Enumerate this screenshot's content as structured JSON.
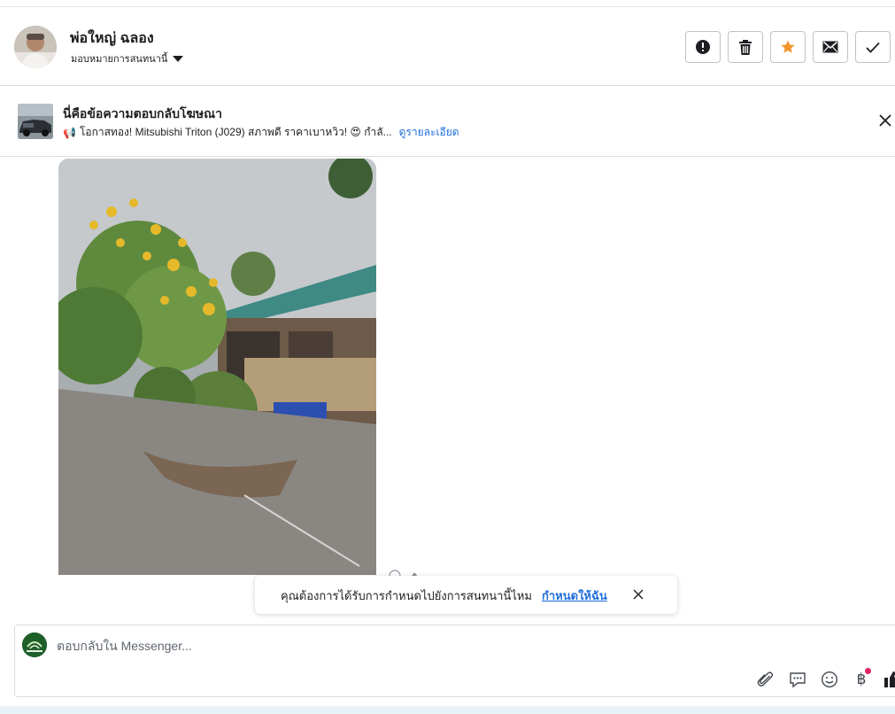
{
  "header": {
    "contact_name": "พ่อใหญ่ ฉลอง",
    "assign_label": "มอบหมายการสนทนานี้",
    "action_icons": [
      "alert-circle-icon",
      "trash-icon",
      "star-icon",
      "envelope-icon",
      "check-icon"
    ],
    "accent_star_color": "#f5942a"
  },
  "ad_banner": {
    "title": "นี่คือข้อความตอบกลับโฆษณา",
    "emoji_prefix": "📢",
    "subtitle": "โอกาสทอง! Mitsubishi Triton (J029) สภาพดี ราคาเบาหวิว! 😍 กำลั...",
    "details_link": "ดูรายละเอียด"
  },
  "message": {
    "type": "image",
    "description_icons": [
      "emoji-react-icon",
      "share-icon"
    ]
  },
  "toast": {
    "text": "คุณต้องการได้รับการกำหนดไปยังการสนทนานี้ไหม",
    "link": "กำหนดให้ฉัน"
  },
  "composer": {
    "placeholder": "ตอบกลับใน Messenger...",
    "tools": [
      "paperclip-icon",
      "saved-reply-icon",
      "emoji-icon",
      "baht-icon",
      "thumbs-up-icon"
    ],
    "baht_symbol": "฿"
  },
  "colors": {
    "link": "#216fdb",
    "border": "#dadde1",
    "notification": "#e0245e"
  }
}
